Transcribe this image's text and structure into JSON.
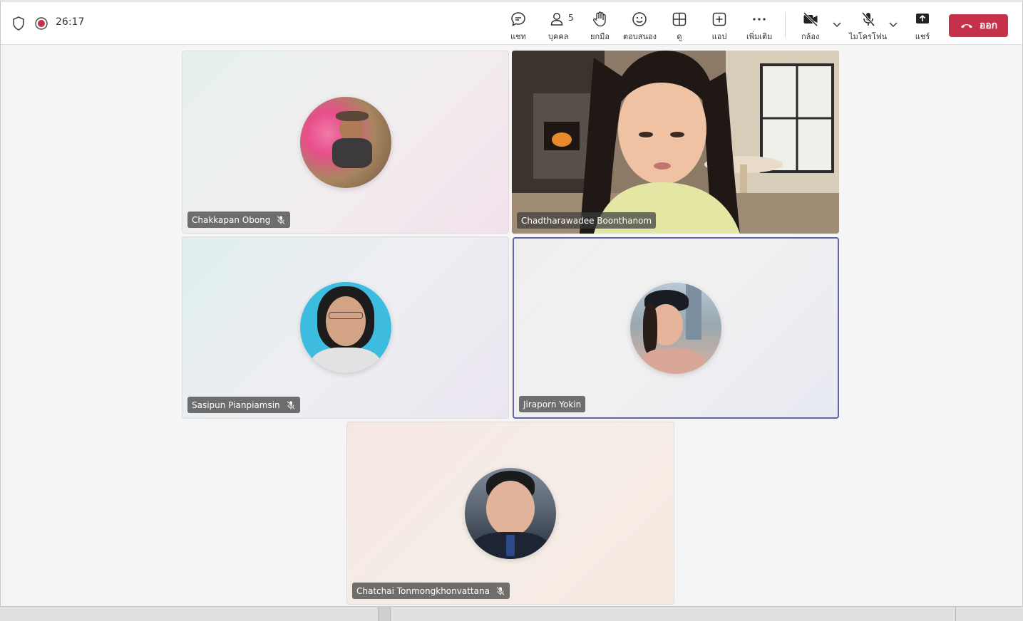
{
  "meeting": {
    "timer": "26:17"
  },
  "toolbar": {
    "chat_label": "แชท",
    "people_label": "บุคคล",
    "people_count": "5",
    "raise_hand_label": "ยกมือ",
    "react_label": "ตอบสนอง",
    "view_label": "ดู",
    "apps_label": "แอป",
    "more_label": "เพิ่มเติม",
    "camera_label": "กล้อง",
    "mic_label": "ไมโครโฟน",
    "share_label": "แชร์",
    "leave_label": "ออก"
  },
  "participants": [
    {
      "name": "Chakkapan Obong",
      "muted": true,
      "video": false
    },
    {
      "name": "Chadtharawadee Boonthanom",
      "muted": false,
      "video": true
    },
    {
      "name": "Sasipun Pianpiamsin",
      "muted": true,
      "video": false
    },
    {
      "name": "Jiraporn Yokin",
      "muted": false,
      "video": false,
      "active_speaker": true
    },
    {
      "name": "Chatchai Tonmongkhonvattana",
      "muted": true,
      "video": false
    }
  ],
  "colors": {
    "leave_button": "#c4314b",
    "active_speaker_border": "#6264a7",
    "recording": "#c4314b"
  }
}
